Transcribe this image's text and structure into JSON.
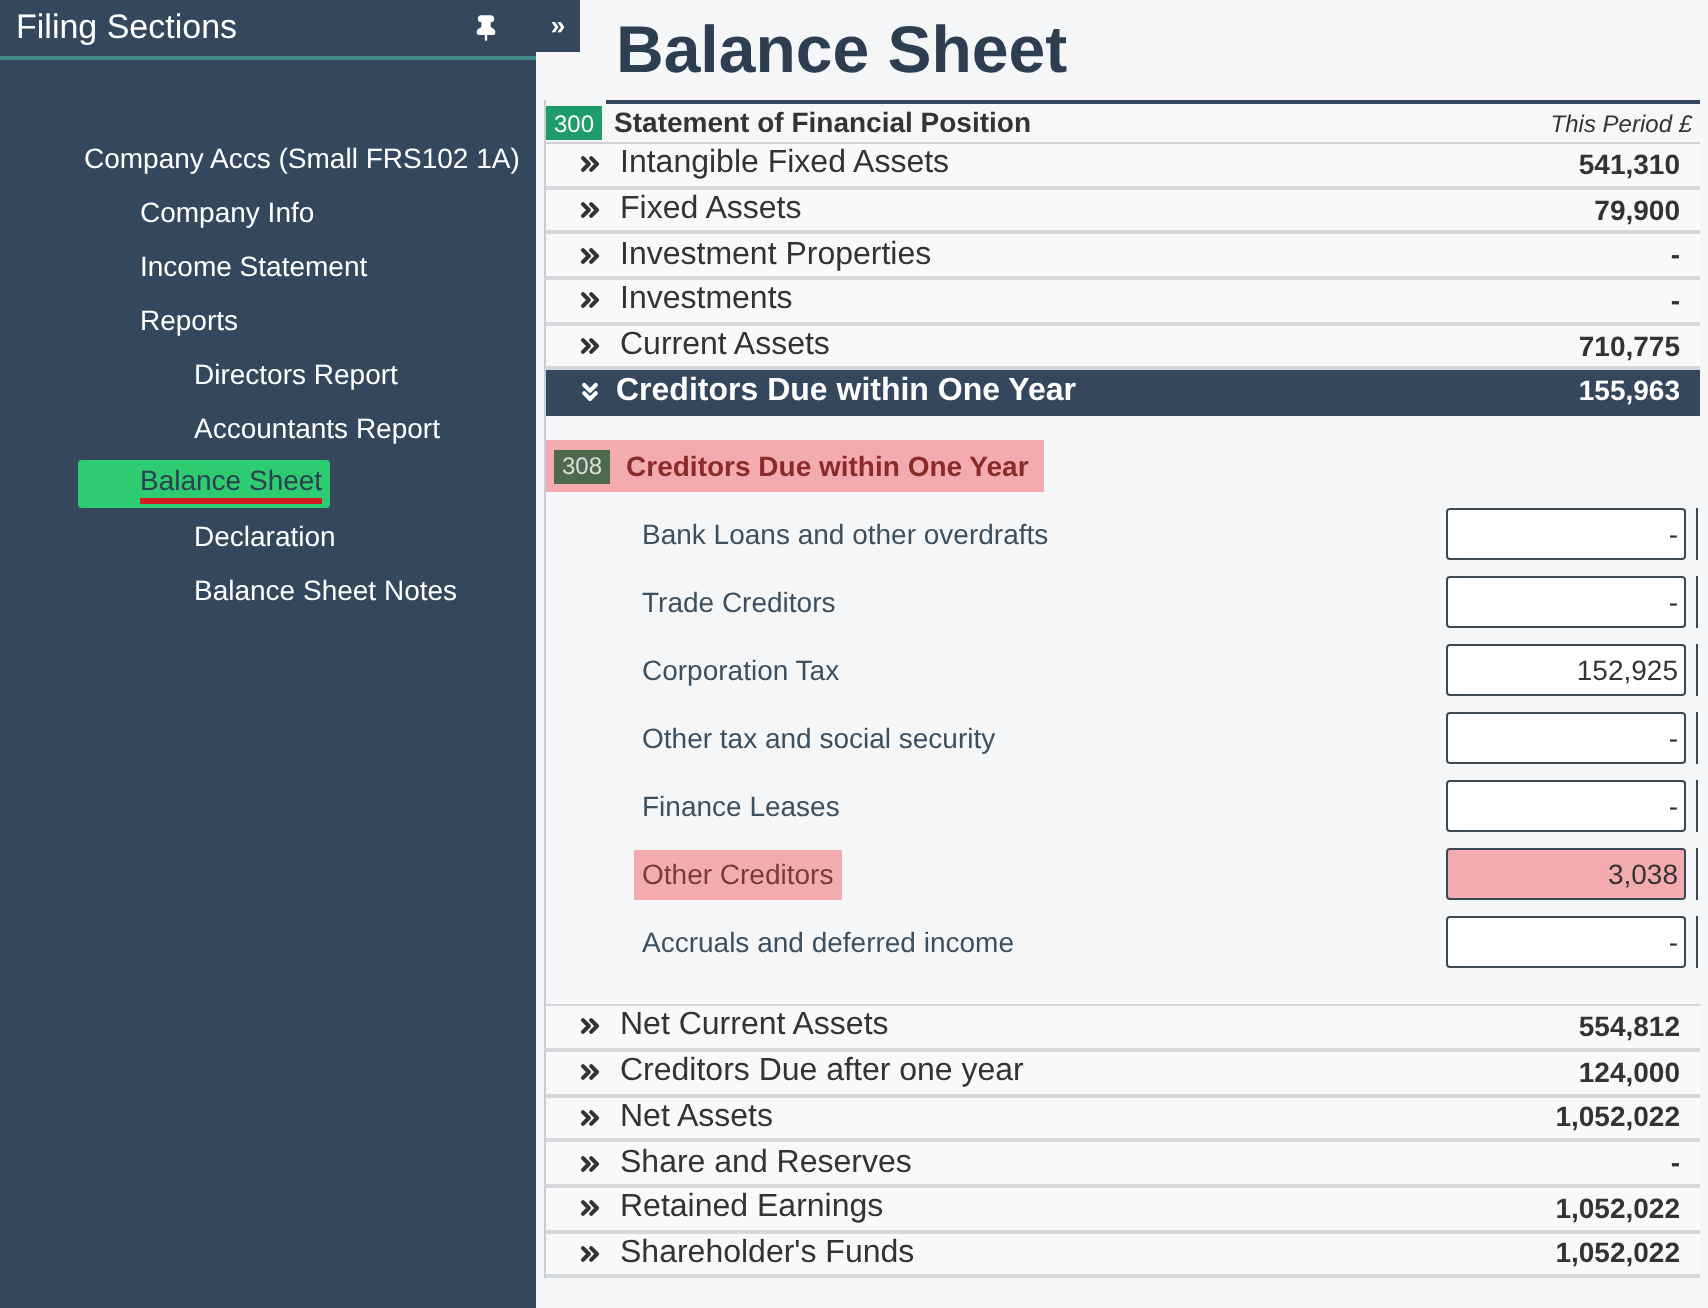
{
  "sidebar": {
    "title": "Filing Sections",
    "collapse_button": "»",
    "items": [
      {
        "label": "Company Accs (Small FRS102 1A)",
        "selected": false,
        "children": [
          {
            "label": "Company Info",
            "selected": false
          },
          {
            "label": "Income Statement",
            "selected": false
          },
          {
            "label": "Reports",
            "selected": false,
            "children": [
              {
                "label": "Directors Report",
                "selected": false
              },
              {
                "label": "Accountants Report",
                "selected": false
              }
            ]
          },
          {
            "label": "Balance Sheet",
            "selected": true,
            "children": [
              {
                "label": "Declaration",
                "selected": false
              },
              {
                "label": "Balance Sheet Notes",
                "selected": false
              }
            ]
          }
        ]
      }
    ]
  },
  "page_title": "Balance Sheet",
  "statement": {
    "badge": "300",
    "title": "Statement of Financial Position",
    "column_header": "This Period £"
  },
  "rows": [
    {
      "label": "Intangible Fixed Assets",
      "value": "541,310",
      "expanded": false
    },
    {
      "label": "Fixed Assets",
      "value": "79,900",
      "expanded": false
    },
    {
      "label": "Investment Properties",
      "value": "-",
      "expanded": false
    },
    {
      "label": "Investments",
      "value": "-",
      "expanded": false
    },
    {
      "label": "Current Assets",
      "value": "710,775",
      "expanded": false
    },
    {
      "label": "Creditors Due within One Year",
      "value": "155,963",
      "expanded": true,
      "detail": {
        "badge": "308",
        "title": "Creditors Due within One Year",
        "highlighted": true,
        "items": [
          {
            "label": "Bank Loans and other overdrafts",
            "value": "-",
            "highlighted": false
          },
          {
            "label": "Trade Creditors",
            "value": "-",
            "highlighted": false
          },
          {
            "label": "Corporation Tax",
            "value": "152,925",
            "highlighted": false
          },
          {
            "label": "Other tax and social security",
            "value": "-",
            "highlighted": false
          },
          {
            "label": "Finance Leases",
            "value": "-",
            "highlighted": false
          },
          {
            "label": "Other Creditors",
            "value": "3,038",
            "highlighted": true
          },
          {
            "label": "Accruals and deferred income",
            "value": "-",
            "highlighted": false
          }
        ]
      }
    },
    {
      "label": "Net Current Assets",
      "value": "554,812",
      "expanded": false
    },
    {
      "label": "Creditors Due after one year",
      "value": "124,000",
      "expanded": false
    },
    {
      "label": "Net Assets",
      "value": "1,052,022",
      "expanded": false
    },
    {
      "label": "Share and Reserves",
      "value": "-",
      "expanded": false
    },
    {
      "label": "Retained Earnings",
      "value": "1,052,022",
      "expanded": false
    },
    {
      "label": "Shareholder's Funds",
      "value": "1,052,022",
      "expanded": false
    }
  ]
}
